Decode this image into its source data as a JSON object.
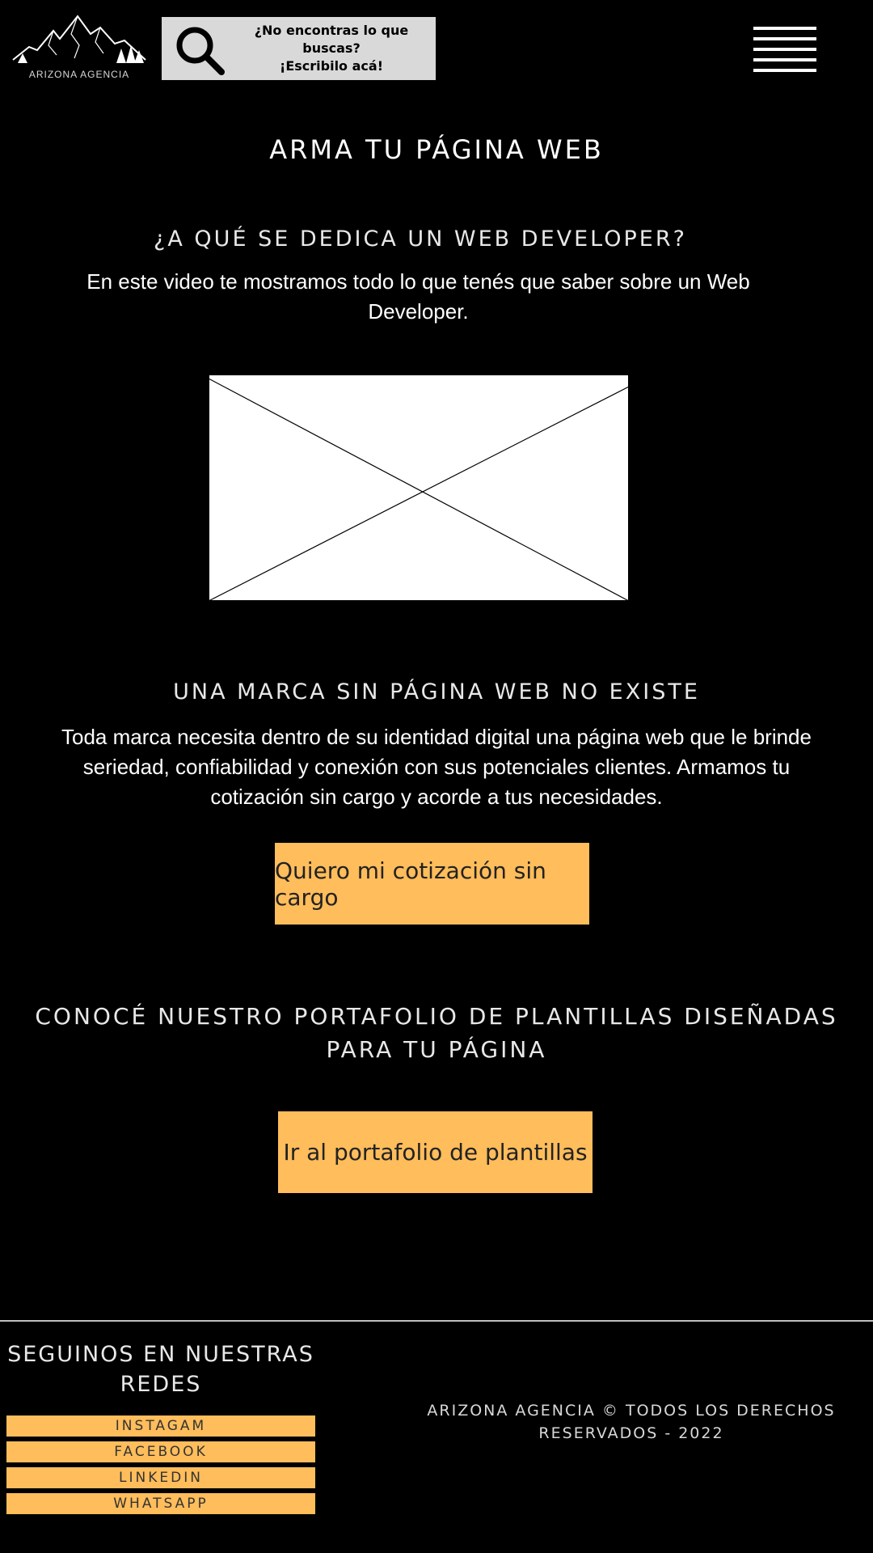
{
  "header": {
    "logo_text": "ARIZONA AGENCIA",
    "search": {
      "line1": "¿No encontras lo que",
      "line2": "buscas?",
      "line3": "¡Escribilo acá!"
    },
    "menu_icon": "hamburger-menu-icon"
  },
  "main": {
    "title": "ARMA TU PÁGINA WEB",
    "webdev": {
      "heading": "¿A QUÉ SE DEDICA UN WEB DEVELOPER?",
      "text": "En este video te mostramos todo lo que tenés que saber sobre un Web Developer."
    },
    "marca": {
      "heading": "UNA MARCA SIN PÁGINA WEB NO EXISTE",
      "text": "Toda marca necesita dentro de su identidad digital una página web que le brinde seriedad, confiabilidad y conexión con sus potenciales clientes. Armamos tu cotización sin cargo y acorde a tus necesidades.",
      "cta": "Quiero mi cotización sin cargo"
    },
    "portafolio": {
      "heading": "CONOCÉ NUESTRO PORTAFOLIO DE PLANTILLAS DISEÑADAS PARA TU PÁGINA",
      "cta": "Ir al portafolio de plantillas"
    }
  },
  "footer": {
    "social_heading": "SEGUINOS EN NUESTRAS REDES",
    "social_links": [
      "INSTAGAM",
      "FACEBOOK",
      "LINKEDIN",
      "WHATSAPP"
    ],
    "copyright": "ARIZONA AGENCIA © TODOS LOS DERECHOS RESERVADOS - 2022"
  },
  "colors": {
    "background": "#000000",
    "accent": "#ffbd5b",
    "search_bg": "#d9d9d9"
  }
}
